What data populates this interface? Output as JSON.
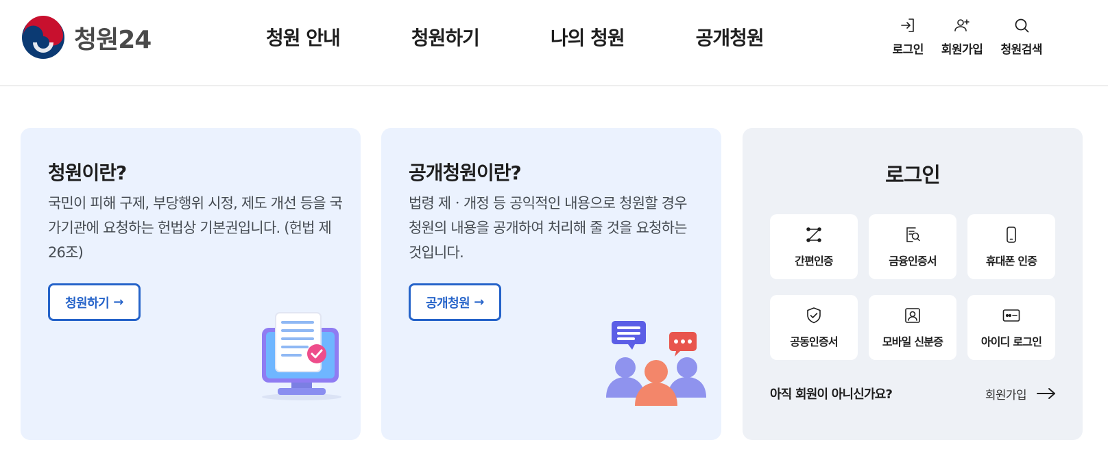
{
  "header": {
    "logo_text": "청원24",
    "nav": [
      {
        "label": "청원 안내"
      },
      {
        "label": "청원하기"
      },
      {
        "label": "나의 청원"
      },
      {
        "label": "공개청원"
      }
    ],
    "utility": [
      {
        "label": "로그인",
        "icon": "login-icon"
      },
      {
        "label": "회원가입",
        "icon": "user-add-icon"
      },
      {
        "label": "청원검색",
        "icon": "search-icon"
      }
    ]
  },
  "petition_card": {
    "title": "청원이란?",
    "desc": "국민이 피해 구제, 부당행위 시정, 제도 개선 등을 국가기관에 요청하는 헌법상 기본권입니다. (헌법 제 26조)",
    "button_label": "청원하기",
    "button_arrow": "→"
  },
  "public_card": {
    "title": "공개청원이란?",
    "desc": "법령 제ㆍ개정 등 공익적인 내용으로 청원할 경우 청원의 내용을 공개하여 처리해 줄 것을 요청하는 것입니다.",
    "button_label": "공개청원",
    "button_arrow": "→"
  },
  "login_panel": {
    "title": "로그인",
    "methods": [
      {
        "label": "간편인증",
        "icon": "simple-auth-icon"
      },
      {
        "label": "금융인증서",
        "icon": "financial-cert-icon"
      },
      {
        "label": "휴대폰 인증",
        "icon": "mobile-phone-icon"
      },
      {
        "label": "공동인증서",
        "icon": "shield-check-icon"
      },
      {
        "label": "모바일 신분증",
        "icon": "id-card-icon"
      },
      {
        "label": "아이디 로그인",
        "icon": "password-icon"
      }
    ],
    "signup_question": "아직 회원이 아니신가요?",
    "signup_link": "회원가입"
  },
  "colors": {
    "accent": "#2563c9",
    "card_blue": "#ebf2fe",
    "card_gray": "#eef1f6",
    "logo_blue": "#0b3a73",
    "logo_red": "#c8102e"
  }
}
